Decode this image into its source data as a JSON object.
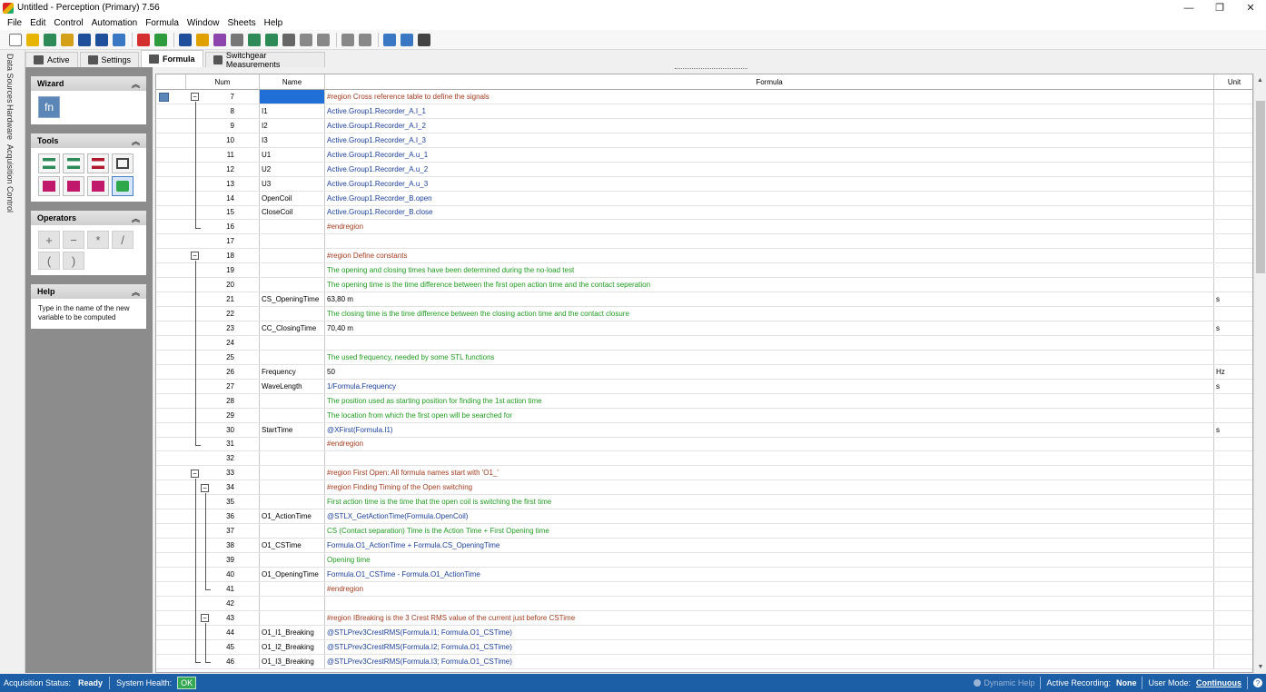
{
  "window": {
    "title": "Untitled - Perception (Primary) 7.56",
    "minimize": "—",
    "maximize": "❐",
    "close": "✕"
  },
  "menu": [
    "File",
    "Edit",
    "Control",
    "Automation",
    "Formula",
    "Window",
    "Sheets",
    "Help"
  ],
  "toolbar_colors": [
    "#ffffff",
    "#e7b400",
    "#2e8b57",
    "#d4a017",
    "#1f4f9b",
    "#1f4f9b",
    "#3b78c4",
    "#d32f2f",
    "#2e9b3c",
    "#1f4f9b",
    "#e0a000",
    "#8e44ad",
    "#777777",
    "#2e8b57",
    "#2e8b57",
    "#666666",
    "#888888",
    "#888888",
    "#888888",
    "#888888",
    "#3b78c4",
    "#3b78c4",
    "#444444"
  ],
  "tabs": [
    {
      "label": "Active",
      "active": false
    },
    {
      "label": "Settings",
      "active": false
    },
    {
      "label": "Formula",
      "active": true
    },
    {
      "label": "Switchgear Measurements",
      "active": false
    }
  ],
  "vstrip": [
    "Data Sources",
    "Hardware",
    "Acquisition Control"
  ],
  "sidebar": {
    "wizard": {
      "title": "Wizard",
      "fn_label": "fn"
    },
    "tools": {
      "title": "Tools"
    },
    "operators": {
      "title": "Operators",
      "items": [
        "+",
        "−",
        "*",
        "/",
        "(",
        ")"
      ]
    },
    "help": {
      "title": "Help",
      "text": "Type in the name of the new variable to be computed"
    }
  },
  "table": {
    "columns": {
      "num": "Num",
      "name": "Name",
      "formula": "Formula",
      "unit": "Unit"
    },
    "rows": [
      {
        "num": "7",
        "name": "",
        "formula": "#region Cross reference table to define the signals",
        "unit": "",
        "kind": "region"
      },
      {
        "num": "8",
        "name": "I1",
        "formula": "Active.Group1.Recorder_A.I_1",
        "unit": "",
        "kind": "ref"
      },
      {
        "num": "9",
        "name": "I2",
        "formula": "Active.Group1.Recorder_A.I_2",
        "unit": "",
        "kind": "ref"
      },
      {
        "num": "10",
        "name": "I3",
        "formula": "Active.Group1.Recorder_A.I_3",
        "unit": "",
        "kind": "ref"
      },
      {
        "num": "11",
        "name": "U1",
        "formula": "Active.Group1.Recorder_A.u_1",
        "unit": "",
        "kind": "ref"
      },
      {
        "num": "12",
        "name": "U2",
        "formula": "Active.Group1.Recorder_A.u_2",
        "unit": "",
        "kind": "ref"
      },
      {
        "num": "13",
        "name": "U3",
        "formula": "Active.Group1.Recorder_A.u_3",
        "unit": "",
        "kind": "ref"
      },
      {
        "num": "14",
        "name": "OpenCoil",
        "formula": "Active.Group1.Recorder_B.open",
        "unit": "",
        "kind": "ref"
      },
      {
        "num": "15",
        "name": "CloseCoil",
        "formula": "Active.Group1.Recorder_B.close",
        "unit": "",
        "kind": "ref"
      },
      {
        "num": "16",
        "name": "",
        "formula": "#endregion",
        "unit": "",
        "kind": "region"
      },
      {
        "num": "17",
        "name": "",
        "formula": "",
        "unit": "",
        "kind": "code"
      },
      {
        "num": "18",
        "name": "",
        "formula": "#region Define constants",
        "unit": "",
        "kind": "region"
      },
      {
        "num": "19",
        "name": "",
        "formula": "The opening and closing times have been determined during the no-load test",
        "unit": "",
        "kind": "comment"
      },
      {
        "num": "20",
        "name": "",
        "formula": "The opening time is the time difference between the first open action time and the contact seperation",
        "unit": "",
        "kind": "comment"
      },
      {
        "num": "21",
        "name": "CS_OpeningTime",
        "formula": "63,80 m",
        "unit": "s",
        "kind": "code"
      },
      {
        "num": "22",
        "name": "",
        "formula": "The closing time is the time difference between the closing action time and the contact closure",
        "unit": "",
        "kind": "comment"
      },
      {
        "num": "23",
        "name": "CC_ClosingTime",
        "formula": "70,40 m",
        "unit": "s",
        "kind": "code"
      },
      {
        "num": "24",
        "name": "",
        "formula": "",
        "unit": "",
        "kind": "code"
      },
      {
        "num": "25",
        "name": "",
        "formula": "The used frequency, needed by some STL functions",
        "unit": "",
        "kind": "comment"
      },
      {
        "num": "26",
        "name": "Frequency",
        "formula": "50",
        "unit": "Hz",
        "kind": "code"
      },
      {
        "num": "27",
        "name": "WaveLength",
        "formula": "1/Formula.Frequency",
        "unit": "s",
        "kind": "ref"
      },
      {
        "num": "28",
        "name": "",
        "formula": "The position used as starting position for finding the 1st action time",
        "unit": "",
        "kind": "comment"
      },
      {
        "num": "29",
        "name": "",
        "formula": "The location from which the first open will be searched for",
        "unit": "",
        "kind": "comment"
      },
      {
        "num": "30",
        "name": "StartTime",
        "formula": "@XFirst(Formula.I1)",
        "unit": "s",
        "kind": "ref"
      },
      {
        "num": "31",
        "name": "",
        "formula": "#endregion",
        "unit": "",
        "kind": "region"
      },
      {
        "num": "32",
        "name": "",
        "formula": "",
        "unit": "",
        "kind": "code"
      },
      {
        "num": "33",
        "name": "",
        "formula": "#region First Open: All formula names start with 'O1_'",
        "unit": "",
        "kind": "region"
      },
      {
        "num": "34",
        "name": "",
        "formula": "#region Finding Timing of the Open switching",
        "unit": "",
        "kind": "region"
      },
      {
        "num": "35",
        "name": "",
        "formula": "First action time is the time that the open coil is switching the first time",
        "unit": "",
        "kind": "comment"
      },
      {
        "num": "36",
        "name": "O1_ActionTime",
        "formula": "@STLX_GetActionTime(Formula.OpenCoil)",
        "unit": "",
        "kind": "ref"
      },
      {
        "num": "37",
        "name": "",
        "formula": "CS (Contact separation) Time is the Action Time + First Opening time",
        "unit": "",
        "kind": "comment"
      },
      {
        "num": "38",
        "name": "O1_CSTime",
        "formula": "Formula.O1_ActionTime + Formula.CS_OpeningTime",
        "unit": "",
        "kind": "ref"
      },
      {
        "num": "39",
        "name": "",
        "formula": "Opening time",
        "unit": "",
        "kind": "comment"
      },
      {
        "num": "40",
        "name": "O1_OpeningTime",
        "formula": "Formula.O1_CSTime - Formula.O1_ActionTime",
        "unit": "",
        "kind": "ref"
      },
      {
        "num": "41",
        "name": "",
        "formula": "#endregion",
        "unit": "",
        "kind": "region"
      },
      {
        "num": "42",
        "name": "",
        "formula": "",
        "unit": "",
        "kind": "code"
      },
      {
        "num": "43",
        "name": "",
        "formula": "#region IBreaking is the 3  Crest RMS value of the current just before CSTime",
        "unit": "",
        "kind": "region"
      },
      {
        "num": "44",
        "name": "O1_I1_Breaking",
        "formula": "@STLPrev3CrestRMS(Formula.I1; Formula.O1_CSTime)",
        "unit": "",
        "kind": "ref"
      },
      {
        "num": "45",
        "name": "O1_I2_Breaking",
        "formula": "@STLPrev3CrestRMS(Formula.I2; Formula.O1_CSTime)",
        "unit": "",
        "kind": "ref"
      },
      {
        "num": "46",
        "name": "O1_I3_Breaking",
        "formula": "@STLPrev3CrestRMS(Formula.I3; Formula.O1_CSTime)",
        "unit": "",
        "kind": "ref"
      }
    ]
  },
  "status": {
    "acq_label": "Acquisition Status:",
    "acq_value": "Ready",
    "health_label": "System Health:",
    "health_value": "OK",
    "dynamic_help": "Dynamic Help",
    "recording_label": "Active Recording:",
    "recording_value": "None",
    "mode_label": "User Mode:",
    "mode_value": "Continuous",
    "help_icon": "?"
  },
  "colors": {
    "status_bar": "#1d5fa6",
    "selection": "#1f6fd6",
    "region": "#a23b1e",
    "comment": "#1f9a1f",
    "ref": "#1a3f9b"
  }
}
